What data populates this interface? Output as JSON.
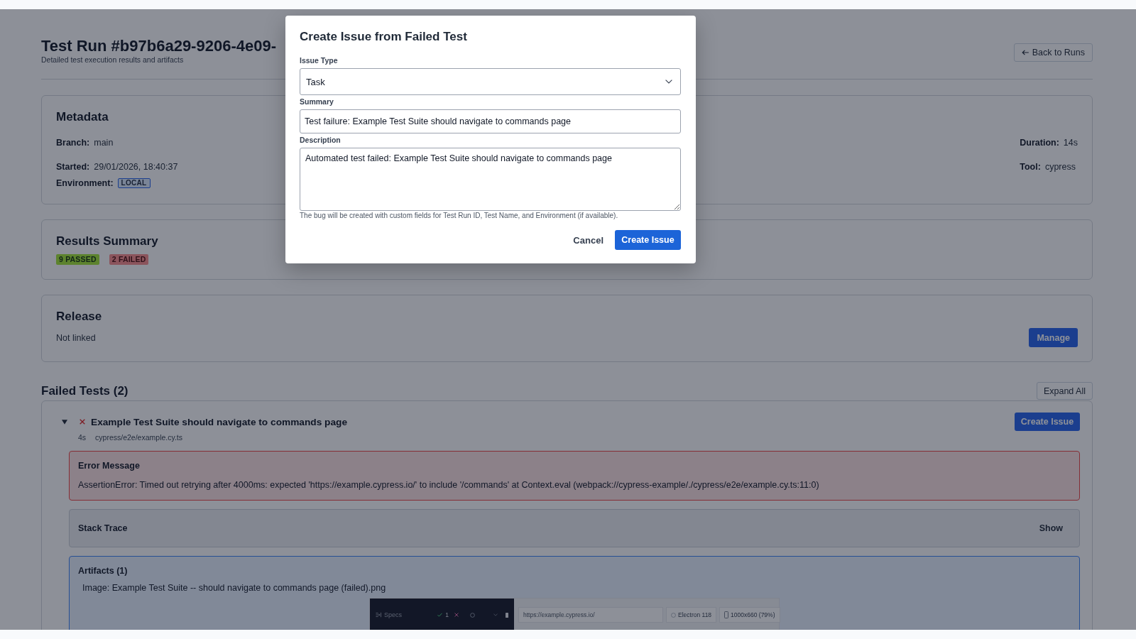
{
  "page_header": {
    "title": "Test Run #b97b6a29-9206-4e09-",
    "subtitle": "Detailed test execution results and artifacts",
    "back_button": "Back to Runs"
  },
  "metadata": {
    "title": "Metadata",
    "fields": [
      {
        "label": "Branch:",
        "value": "main",
        "kind": "text"
      },
      {
        "label": "Started:",
        "value": "29/01/2026, 18:40:37",
        "kind": "text"
      },
      {
        "label": "Environment:",
        "value": "LOCAL",
        "kind": "badge"
      }
    ],
    "side_fields": [
      {
        "label": "Duration:",
        "value": "14s",
        "kind": "text"
      },
      {
        "label": "Tool:",
        "value": "cypress",
        "kind": "text"
      }
    ]
  },
  "results_summary": {
    "title": "Results Summary",
    "badges": [
      {
        "label": "9 PASSED",
        "kind": "passed"
      },
      {
        "label": "2 FAILED",
        "kind": "failed"
      }
    ]
  },
  "release": {
    "title": "Release",
    "status": "Not linked",
    "button": "Manage"
  },
  "failed_tests": {
    "title": "Failed Tests (2)",
    "expand_button": "Expand All",
    "tests": [
      {
        "expanded": true,
        "title": "Example Test Suite should navigate to commands page",
        "duration": "4s",
        "file": "cypress/e2e/example.cy.ts",
        "button": "Create Issue",
        "error": {
          "title": "Error Message",
          "message": "AssertionError: Timed out retrying after 4000ms: expected 'https://example.cypress.io/' to include '/commands' at Context.eval (webpack://cypress-example/./cypress/e2e/example.cy.ts:11:0)"
        },
        "stack_trace": {
          "title": "Stack Trace",
          "toggle": "Show"
        },
        "artifacts": {
          "title": "Artifacts (1)",
          "items": [
            {
              "label": "Image: Example Test Suite -- should navigate to commands page (failed).png",
              "preview": {
                "specs_label": "Specs",
                "passed_count": "1",
                "url": "https://example.cypress.io/",
                "browser": "Electron 118",
                "viewport_size": "1000x660 (79%)"
              }
            }
          ]
        }
      }
    ]
  },
  "modal": {
    "title": "Create Issue from Failed Test",
    "fields": [
      {
        "label": "Issue Type",
        "kind": "select",
        "value": "Task"
      },
      {
        "label": "Summary",
        "kind": "input",
        "value": "Test failure: Example Test Suite should navigate to commands page"
      },
      {
        "label": "Description",
        "kind": "textarea",
        "value": "Automated test failed: Example Test Suite should navigate to commands page"
      }
    ],
    "hint": "The bug will be created with custom fields for Test Run ID, Test Name, and Environment (if available).",
    "buttons": [
      {
        "label": "Cancel",
        "kind": "secondary"
      },
      {
        "label": "Create Issue",
        "kind": "primary"
      }
    ]
  }
}
